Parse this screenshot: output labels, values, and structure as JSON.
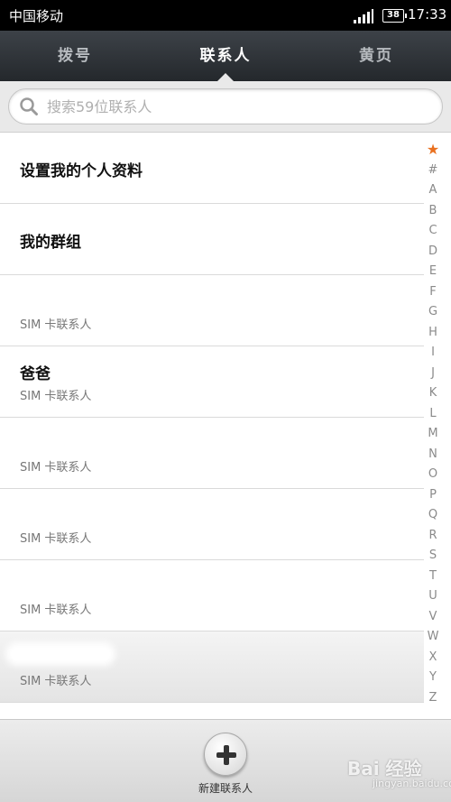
{
  "status_bar": {
    "carrier": "中国移动",
    "battery": "38",
    "time": "17:33"
  },
  "tabs": [
    {
      "label": "拨号",
      "active": false
    },
    {
      "label": "联系人",
      "active": true
    },
    {
      "label": "黄页",
      "active": false
    }
  ],
  "search": {
    "placeholder": "搜索59位联系人"
  },
  "contacts": [
    {
      "name": "设置我的个人资料",
      "sub": ""
    },
    {
      "name": "我的群组",
      "sub": ""
    },
    {
      "name": "",
      "sub": "SIM 卡联系人"
    },
    {
      "name": "爸爸",
      "sub": "SIM 卡联系人"
    },
    {
      "name": "",
      "sub": "SIM 卡联系人"
    },
    {
      "name": "",
      "sub": "SIM 卡联系人"
    },
    {
      "name": "",
      "sub": "SIM 卡联系人"
    },
    {
      "name": "",
      "sub": "SIM 卡联系人"
    }
  ],
  "index_letters": [
    "★",
    "#",
    "A",
    "B",
    "C",
    "D",
    "E",
    "F",
    "G",
    "H",
    "I",
    "J",
    "K",
    "L",
    "M",
    "N",
    "O",
    "P",
    "Q",
    "R",
    "S",
    "T",
    "U",
    "V",
    "W",
    "X",
    "Y",
    "Z"
  ],
  "add_contact": {
    "label": "新建联系人",
    "icon": "plus-icon"
  },
  "watermark": {
    "brand": "Bai 经验",
    "url": "jingyan.baidu.com"
  },
  "colors": {
    "tab_bar": "#2e3237",
    "index_star": "#e9701f"
  }
}
